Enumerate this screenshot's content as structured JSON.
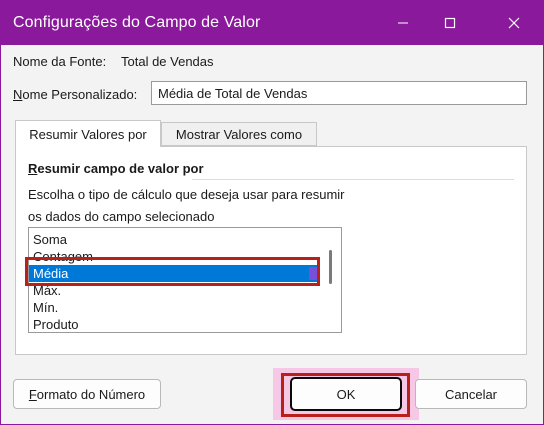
{
  "window": {
    "title": "Configurações do Campo de Valor",
    "titlebar_color": "#8a1a9b"
  },
  "source": {
    "label": "Nome da Fonte:",
    "value": "Total de Vendas"
  },
  "custom_name": {
    "label": "Nome Personalizado:",
    "label_underline_char": "N",
    "label_rest": "ome Personalizado:",
    "value": "Média de Total de Vendas"
  },
  "tabs": [
    {
      "label": "Resumir Valores por",
      "active": true
    },
    {
      "label": "Mostrar Valores como",
      "active": false
    }
  ],
  "summarize": {
    "section_title_underline": "R",
    "section_title_rest": "esumir campo de valor por",
    "description_line1": "Escolha o tipo de cálculo que deseja usar para resumir",
    "description_line2": "os dados do campo selecionado",
    "options": [
      "Soma",
      "Contagem",
      "Média",
      "Máx.",
      "Mín.",
      "Produto"
    ],
    "selected": "Média",
    "selection_color": "#0078d7"
  },
  "buttons": {
    "format_underline": "F",
    "format_rest": "ormato do Número",
    "ok": "OK",
    "cancel": "Cancelar"
  },
  "annotation_colors": {
    "red_box": "#b8201a",
    "ok_glow": "#f7c8e6"
  },
  "icons": [
    "minimize-icon",
    "maximize-icon",
    "close-icon"
  ]
}
